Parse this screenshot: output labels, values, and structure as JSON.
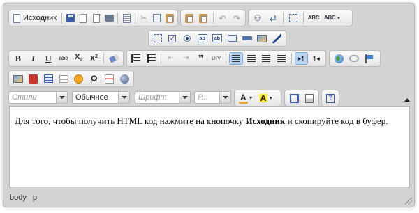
{
  "toolbar": {
    "source_label": "Исходник",
    "styles_placeholder": "Стили",
    "format_value": "Обычное",
    "font_placeholder": "Шрифт",
    "size_placeholder": "Р...",
    "spellcheck_label": "ABC",
    "spellcheck_ayt_label": "ABC"
  },
  "content": {
    "text_before": "Для того, чтобы получить HTML код нажмите на кнопочку ",
    "text_bold": "Исходник",
    "text_after": " и скопируйте код в буфер."
  },
  "statusbar": {
    "path": [
      "body",
      "p"
    ]
  },
  "colors": {
    "background": "#d3d3d3",
    "active_button": "#b8d4f3",
    "accent": "#3a5fa8"
  }
}
